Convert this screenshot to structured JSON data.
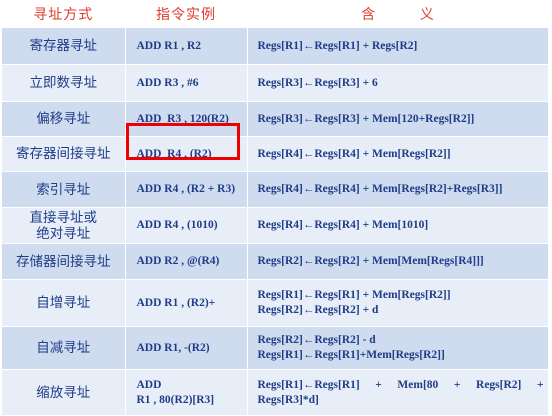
{
  "headers": {
    "mode": "寻址方式",
    "instruction": "指令实例",
    "meaning": "含          义"
  },
  "rows": [
    {
      "mode": "寄存器寻址",
      "instruction": "ADD R1 , R2",
      "meaning": [
        "Regs[R1]←Regs[R1] + Regs[R2]"
      ]
    },
    {
      "mode": "立即数寻址",
      "instruction": "ADD R3 , #6",
      "meaning": [
        "Regs[R3]←Regs[R3] + 6"
      ]
    },
    {
      "mode": "偏移寻址",
      "instruction": "ADD  R3 , 120(R2)",
      "meaning": [
        "Regs[R3]←Regs[R3] + Mem[120+Regs[R2]]"
      ]
    },
    {
      "mode": "寄存器间接寻址",
      "instruction": "ADD  R4 , (R2)",
      "meaning": [
        "Regs[R4]←Regs[R4] + Mem[Regs[R2]]"
      ]
    },
    {
      "mode": "索引寻址",
      "instruction": "ADD  R4 , (R2 + R3)",
      "meaning": [
        "Regs[R4]←Regs[R4] + Mem[Regs[R2]+Regs[R3]]"
      ]
    },
    {
      "mode": "直接寻址或绝对寻址",
      "mode_lines": [
        "直接寻址或",
        "绝对寻址"
      ],
      "instruction": "ADD R4 , (1010)",
      "meaning": [
        "Regs[R4]←Regs[R4] + Mem[1010]"
      ]
    },
    {
      "mode": "存储器间接寻址",
      "instruction": "ADD R2 , @(R4)",
      "meaning": [
        "Regs[R2]←Regs[R2] + Mem[Mem[Regs[R4]]]"
      ]
    },
    {
      "mode": "自增寻址",
      "instruction": "ADD R1 , (R2)+",
      "meaning": [
        "Regs[R1]←Regs[R1] + Mem[Regs[R2]]",
        "Regs[R2]←Regs[R2] + d"
      ]
    },
    {
      "mode": "自减寻址",
      "instruction": "ADD R1, -(R2)",
      "meaning": [
        "Regs[R2]←Regs[R2] - d",
        "Regs[R1]←Regs[R1]+Mem[Regs[R2]]"
      ]
    },
    {
      "mode": "缩放寻址",
      "instruction": "ADD R1 , 80(R2)[R3]",
      "instruction_lines": [
        "ADD",
        "R1 , 80(R2)[R3]"
      ],
      "meaning": [
        "Regs[R1]←Regs[R1] + Mem[80 + Regs[R2] + Regs[R3]*d]"
      ]
    }
  ],
  "highlight": {
    "row_index": 3,
    "color": "#ee0000"
  },
  "colors": {
    "header_text": "#e03a2c",
    "body_text": "#1f3c88",
    "row_dark": "#cfdcef",
    "row_light": "#e8eef8"
  }
}
